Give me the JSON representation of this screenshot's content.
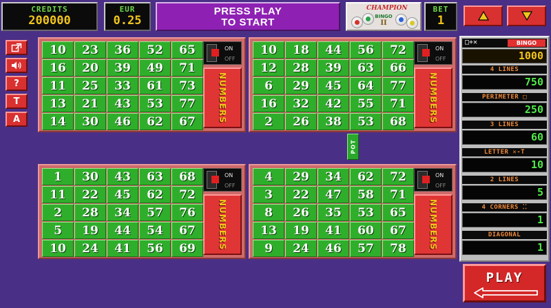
{
  "header": {
    "credits_label": "CREDITS",
    "credits_value": "200000",
    "currency_label": "EUR",
    "currency_value": "0.25",
    "message_line1": "PRESS PLAY",
    "message_line2": "TO START",
    "logo_title": "CHAMPION",
    "logo_subtitle": "BINGO",
    "logo_numeral": "II",
    "bet_label": "BET",
    "bet_value": "1"
  },
  "side_buttons": [
    {
      "name": "fullscreen-button",
      "icon": "fullscreen-icon"
    },
    {
      "name": "sound-button",
      "icon": "speaker-icon"
    },
    {
      "name": "help-button",
      "label": "?"
    },
    {
      "name": "t-button",
      "label": "T"
    },
    {
      "name": "a-button",
      "label": "A"
    }
  ],
  "cards": [
    {
      "rows": [
        [
          10,
          23,
          36,
          52,
          65
        ],
        [
          16,
          20,
          39,
          49,
          71
        ],
        [
          11,
          25,
          33,
          61,
          73
        ],
        [
          13,
          21,
          43,
          53,
          77
        ],
        [
          14,
          30,
          46,
          62,
          67
        ]
      ],
      "switch_on": "ON",
      "switch_off": "OFF",
      "numbers_label": "NUMBERS"
    },
    {
      "rows": [
        [
          10,
          18,
          44,
          56,
          72
        ],
        [
          12,
          28,
          39,
          63,
          66
        ],
        [
          6,
          29,
          45,
          64,
          77
        ],
        [
          16,
          32,
          42,
          55,
          71
        ],
        [
          2,
          26,
          38,
          53,
          68
        ]
      ],
      "switch_on": "ON",
      "switch_off": "OFF",
      "numbers_label": "NUMBERS"
    },
    {
      "rows": [
        [
          1,
          30,
          43,
          63,
          68
        ],
        [
          11,
          22,
          45,
          62,
          72
        ],
        [
          2,
          28,
          34,
          57,
          76
        ],
        [
          5,
          19,
          44,
          54,
          67
        ],
        [
          10,
          24,
          41,
          56,
          69
        ]
      ],
      "switch_on": "ON",
      "switch_off": "OFF",
      "numbers_label": "NUMBERS"
    },
    {
      "rows": [
        [
          4,
          29,
          34,
          62,
          72
        ],
        [
          3,
          22,
          47,
          58,
          71
        ],
        [
          8,
          26,
          35,
          53,
          65
        ],
        [
          13,
          19,
          41,
          60,
          67
        ],
        [
          9,
          24,
          46,
          57,
          78
        ]
      ],
      "switch_on": "ON",
      "switch_off": "OFF",
      "numbers_label": "NUMBERS"
    }
  ],
  "pot_label": "POT",
  "paytable": {
    "head_symbols": "□+✕",
    "head_bingo": "BINGO",
    "top_value": "1000",
    "entries": [
      {
        "label": "4 LINES",
        "value": "750"
      },
      {
        "label": "PERIMETER □",
        "value": "250"
      },
      {
        "label": "3 LINES",
        "value": "60"
      },
      {
        "label": "LETTER ✕-T",
        "value": "10"
      },
      {
        "label": "2 LINES",
        "value": "5"
      },
      {
        "label": "4 CORNERS ⁚⁚",
        "value": "1"
      },
      {
        "label": "DIAGONAL",
        "value": "1"
      }
    ]
  },
  "play_label": "PLAY",
  "colors": {
    "background": "#4a2f86",
    "cell_green": "#2fae2b",
    "card_frame": "#cf6a6a",
    "button_red": "#d93030",
    "message_purple": "#8e21b3",
    "gold": "#f0c51c"
  }
}
